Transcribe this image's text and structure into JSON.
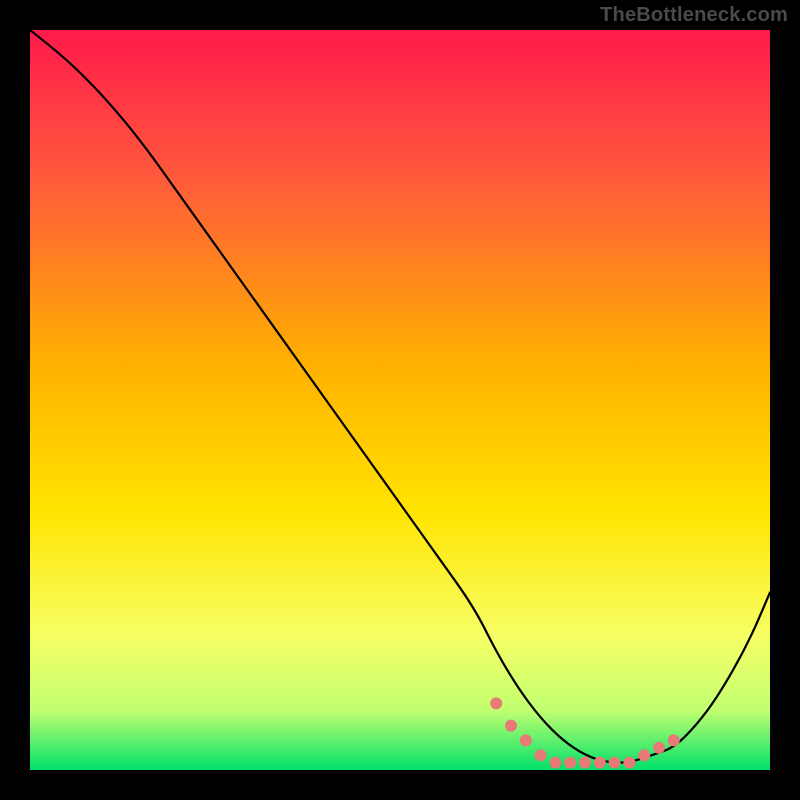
{
  "watermark": "TheBottleneck.com",
  "chart_data": {
    "type": "line",
    "title": "",
    "xlabel": "",
    "ylabel": "",
    "xlim": [
      0,
      100
    ],
    "ylim": [
      0,
      100
    ],
    "grid": false,
    "legend": false,
    "background_gradient": {
      "stops": [
        {
          "offset": 0.0,
          "color": "#ff1a4b"
        },
        {
          "offset": 0.2,
          "color": "#ff5a3c"
        },
        {
          "offset": 0.45,
          "color": "#ffb000"
        },
        {
          "offset": 0.65,
          "color": "#ffe400"
        },
        {
          "offset": 0.82,
          "color": "#f7ff66"
        },
        {
          "offset": 0.92,
          "color": "#c0ff70"
        },
        {
          "offset": 1.0,
          "color": "#00e06a"
        }
      ]
    },
    "series": [
      {
        "name": "bottleneck-curve",
        "color": "#000000",
        "width": 2.2,
        "x": [
          0,
          5,
          10,
          15,
          20,
          25,
          30,
          35,
          40,
          45,
          50,
          55,
          60,
          63,
          66,
          69,
          72,
          75,
          78,
          81,
          84,
          87,
          90,
          93,
          97,
          100
        ],
        "y": [
          100,
          96,
          91,
          85,
          78,
          71,
          64,
          57,
          50,
          43,
          36,
          29,
          22,
          16,
          11,
          7,
          4,
          2,
          1,
          1,
          2,
          3,
          6,
          10,
          17,
          24
        ]
      },
      {
        "name": "optimal-range-markers",
        "color": "#e77a77",
        "type": "scatter",
        "marker_size": 8,
        "x": [
          63,
          65,
          67,
          69,
          71,
          73,
          75,
          77,
          79,
          81,
          83,
          85,
          87
        ],
        "y": [
          9,
          6,
          4,
          2,
          1,
          1,
          1,
          1,
          1,
          1,
          2,
          3,
          4
        ]
      }
    ]
  }
}
